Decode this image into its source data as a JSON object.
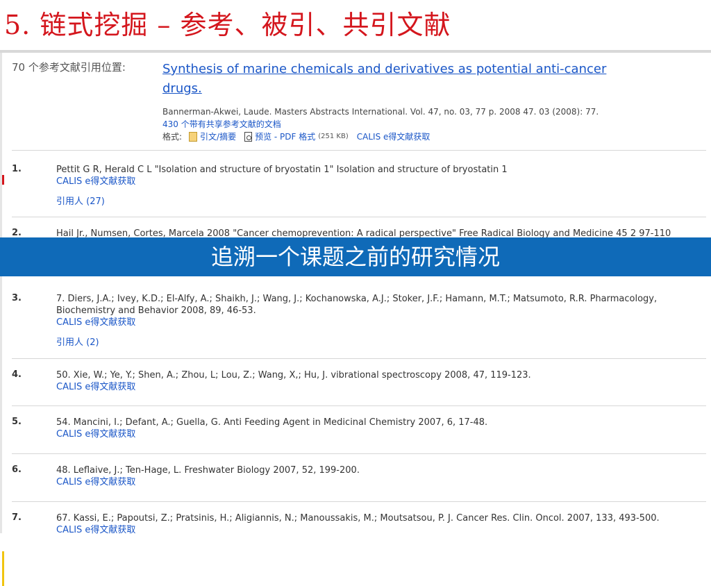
{
  "slide": {
    "title": "5.  链式挖掘  –  参考、被引、共引文献"
  },
  "record": {
    "count_label": "70 个参考文献引用位置:",
    "title": "Synthesis of marine chemicals and derivatives as potential anti-cancer drugs.",
    "meta": "Bannerman-Akwei, Laude. Masters Abstracts International. Vol. 47, no. 03, 77 p. 2008 47. 03  (2008): 77.",
    "shared_refs": "430 个带有共享参考文献的文档",
    "format_label": "格式:",
    "abstract_link": "引文/摘要",
    "preview_link": "预览 - PDF 格式",
    "pdf_size": "(251 KB)",
    "calis_link": "CALIS e得文献获取"
  },
  "references": [
    {
      "num": "1.",
      "text": "Pettit G R, Herald C L \"Isolation and structure of bryostatin 1\" Isolation and structure of bryostatin 1",
      "calis": "CALIS e得文献获取",
      "cited": "引用人 (27)"
    },
    {
      "num": "2.",
      "text": "Hail Jr., Numsen, Cortes, Marcela 2008 \"Cancer chemoprevention: A radical perspective\" Free Radical Biology and Medicine 45 2 97-110"
    },
    {
      "num": "3.",
      "text": "7. Diers, J.A.; Ivey, K.D.; El-Alfy, A.; Shaikh, J.; Wang, J.; Kochanowska, A.J.; Stoker, J.F.; Hamann, M.T.; Matsumoto, R.R. Pharmacology, Biochemistry and Behavior 2008, 89, 46-53.",
      "calis": "CALIS e得文献获取",
      "cited": "引用人 (2)"
    },
    {
      "num": "4.",
      "text": "50. Xie, W.; Ye, Y.; Shen, A.; Zhou, L; Lou, Z.; Wang, X,; Hu, J. vibrational spectroscopy 2008, 47, 119-123.",
      "calis": "CALIS e得文献获取"
    },
    {
      "num": "5.",
      "text": "54. Mancini, I.; Defant, A.; Guella, G. Anti Feeding Agent in Medicinal Chemistry 2007, 6, 17-48.",
      "calis": "CALIS e得文献获取"
    },
    {
      "num": "6.",
      "text": "48. Leflaive, J.; Ten-Hage, L. Freshwater Biology 2007, 52, 199-200.",
      "calis": "CALIS e得文献获取"
    },
    {
      "num": "7.",
      "text": "67. Kassi, E.; Papoutsi, Z.; Pratsinis, H.; Aligiannis, N.; Manoussakis, M.; Moutsatsou, P. J. Cancer Res. Clin. Oncol. 2007, 133, 493-500.",
      "calis": "CALIS e得文献获取"
    }
  ],
  "banner": {
    "text": "追溯一个课题之前的研究情况"
  },
  "colors": {
    "title_red": "#d4161d",
    "link_blue": "#1a56c7",
    "banner_blue": "#0f6ab8"
  }
}
